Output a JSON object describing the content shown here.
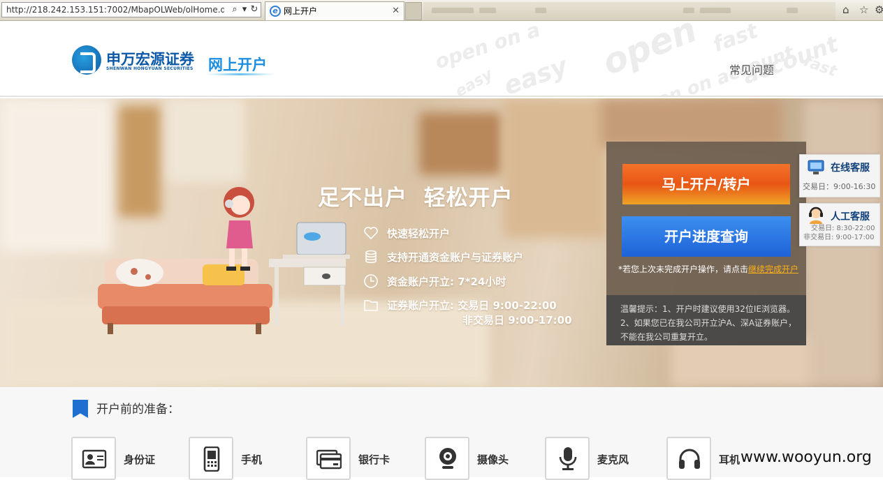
{
  "browser": {
    "url": "http://218.242.153.151:7002/MbapOLWeb/olHome.dc",
    "tab_title": "网上开户"
  },
  "header": {
    "logo_cn": "申万宏源证券",
    "logo_en": "SHENWAN HONGYUAN SECURITIES",
    "logo_sub": "网上开户",
    "faq": "常见问题",
    "watermark_words": [
      "open on a",
      "easy",
      "fast",
      "account",
      "open",
      "open on account",
      "easy",
      "fast"
    ]
  },
  "banner": {
    "slogan": "足不出户  轻松开户",
    "features": [
      {
        "text": "快速轻松开户",
        "icon": "heart-icon"
      },
      {
        "text": "支持开通资金账户与证券账户",
        "icon": "coins-icon"
      },
      {
        "text": "资金账户开立: 7*24小时",
        "icon": "clock-icon"
      },
      {
        "text": "证券账户开立: 交易日  9:00-22:00",
        "icon": "folder-icon"
      }
    ],
    "feature_extra": "非交易日  9:00-17:00"
  },
  "panel": {
    "open_button": "马上开户/转户",
    "query_button": "开户进度查询",
    "note_prefix": "*若您上次未完成开户操作，请点击",
    "note_link": "继续完成开户",
    "tips": [
      "温馨提示：1、开户时建议使用32位IE浏览器。",
      "2、如果您已在我公司开立沪A、深A证券账户，",
      "不能在我公司重复开立。"
    ]
  },
  "service": {
    "online": {
      "title": "在线客服",
      "time": "交易日：9:00-16:30"
    },
    "manual": {
      "title": "人工客服",
      "time1": "交易日: 8:30-22:00",
      "time2": "非交易日: 9:00-17:00"
    }
  },
  "prep": {
    "title": "开户前的准备：",
    "items": [
      "身份证",
      "手机",
      "银行卡",
      "摄像头",
      "麦克风",
      "耳机"
    ]
  },
  "watermark": "www.wooyun.org",
  "colors": {
    "brand_blue": "#0a58a8",
    "open_orange": "#e75614",
    "query_blue": "#1e62d8",
    "panel_brown": "#6e5f50",
    "link_orange": "#ffb11a"
  }
}
